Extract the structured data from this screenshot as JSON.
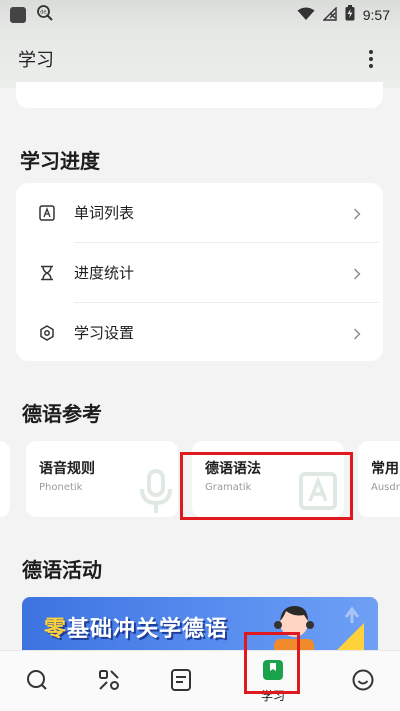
{
  "status_bar": {
    "time": "9:57"
  },
  "app_bar": {
    "title": "学习",
    "menu_icon": "more-vert-icon"
  },
  "progress_section": {
    "title": "学习进度",
    "items": [
      {
        "label": "单词列表",
        "icon": "vocab-list-icon"
      },
      {
        "label": "进度统计",
        "icon": "hourglass-icon"
      },
      {
        "label": "学习设置",
        "icon": "settings-hex-icon"
      }
    ]
  },
  "reference_section": {
    "title": "德语参考",
    "cards": [
      {
        "title": "语音规则",
        "subtitle": "Phonetik",
        "icon": "microphone-icon"
      },
      {
        "title": "德语语法",
        "subtitle": "Gramatik",
        "icon": "grammar-a-icon"
      },
      {
        "title": "常用",
        "subtitle": "Ausdr",
        "icon": ""
      }
    ]
  },
  "activity_section": {
    "title": "德语活动",
    "banner_text_zero": "零",
    "banner_text_rest": "基础冲关学德语"
  },
  "bottom_nav": {
    "items": [
      {
        "label": "",
        "icon": "search-icon"
      },
      {
        "label": "",
        "icon": "apps-icon"
      },
      {
        "label": "",
        "icon": "notes-icon"
      },
      {
        "label": "学习",
        "icon": "book-icon",
        "active": true
      },
      {
        "label": "",
        "icon": "smiley-icon"
      }
    ]
  },
  "colors": {
    "accent": "#1aa34a",
    "highlight": "#e0191f",
    "banner": "#3c73e0"
  }
}
